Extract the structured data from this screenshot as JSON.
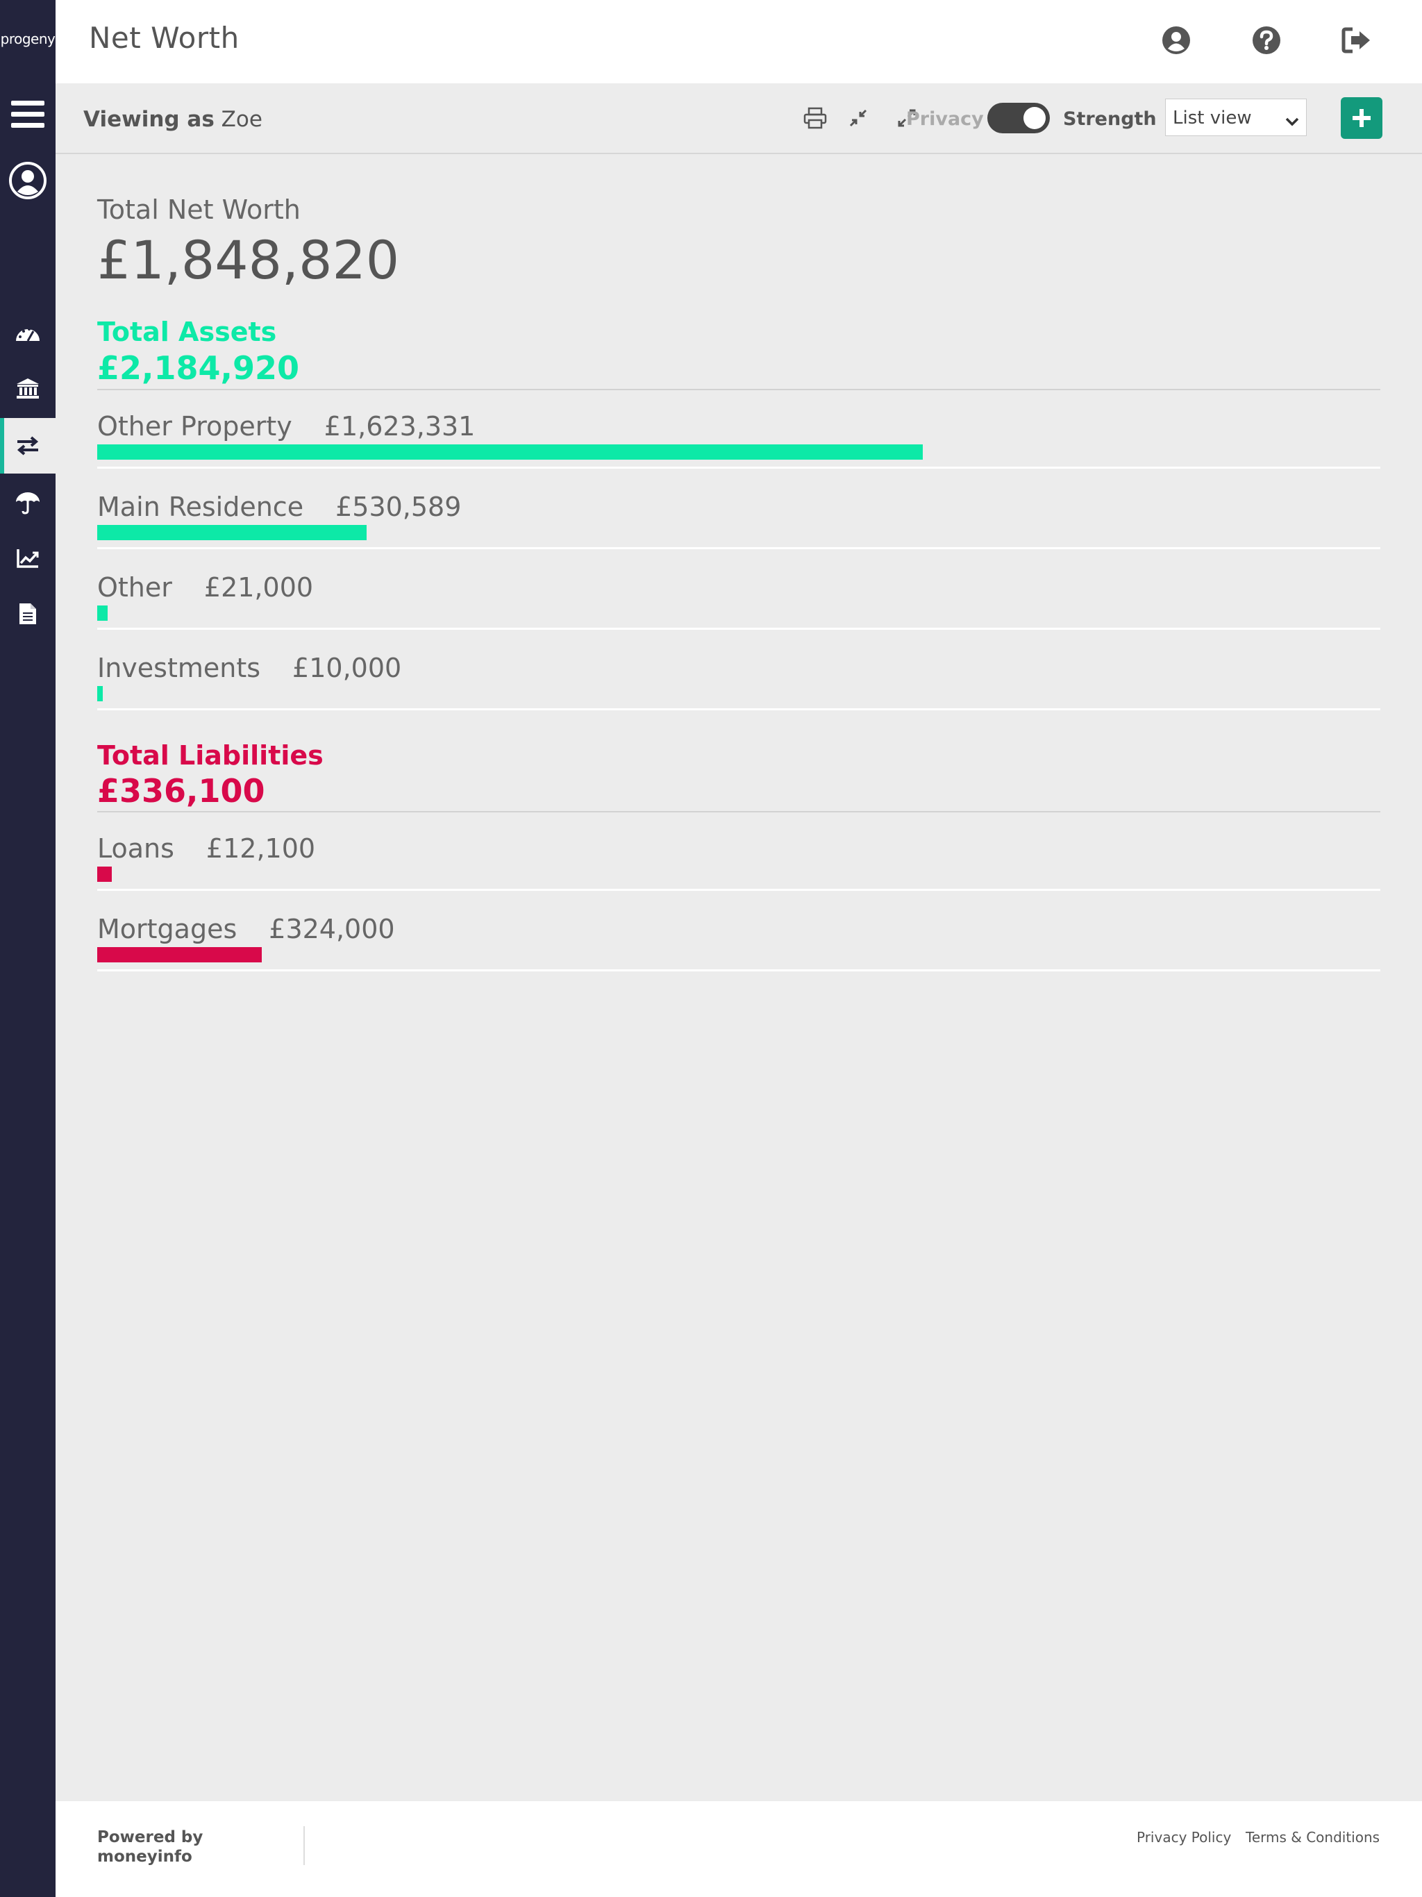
{
  "brand": {
    "name": "progeny",
    "footer_line1": "Powered by",
    "footer_line2": "moneyinfo"
  },
  "header": {
    "title": "Net Worth"
  },
  "toolbar": {
    "viewing_label": "Viewing as",
    "viewing_name": "Zoe",
    "privacy_label": "Privacy",
    "strength_label": "Strength",
    "privacy_toggle_on": true,
    "view_select": "List view"
  },
  "summary": {
    "label": "Total Net Worth",
    "value": "£1,848,820"
  },
  "assets": {
    "title": "Total Assets",
    "total": "£2,184,920",
    "color": "#0de9a7",
    "rows": [
      {
        "label": "Other Property",
        "value": "£1,623,331",
        "share": 0.7429
      },
      {
        "label": "Main Residence",
        "value": "£530,589",
        "share": 0.2428
      },
      {
        "label": "Other",
        "value": "£21,000",
        "share": 0.0096
      },
      {
        "label": "Investments",
        "value": "£10,000",
        "share": 0.0046
      }
    ]
  },
  "liabilities": {
    "title": "Total Liabilities",
    "total": "£336,100",
    "color": "#d8094a",
    "rows": [
      {
        "label": "Loans",
        "value": "£12,100",
        "share": 0.0132
      },
      {
        "label": "Mortgages",
        "value": "£324,000",
        "share": 0.1483
      }
    ]
  },
  "footer": {
    "privacy_policy": "Privacy Policy",
    "terms": "Terms & Conditions"
  },
  "icons": [
    "menu-icon",
    "profile-icon",
    "dashboard-icon",
    "bank-icon",
    "transfer-icon",
    "umbrella-icon",
    "chart-icon",
    "document-icon",
    "user-circle-icon",
    "help-icon",
    "logout-icon",
    "print-icon",
    "compress-icon",
    "expand-icon",
    "plus-icon"
  ]
}
